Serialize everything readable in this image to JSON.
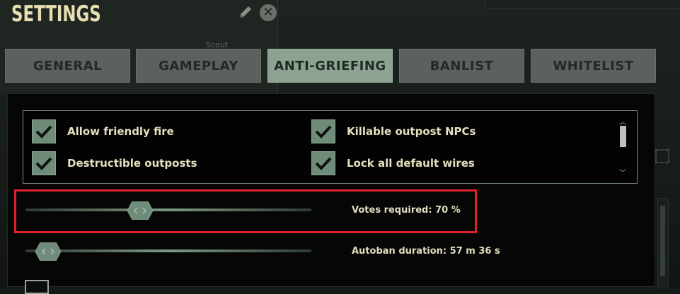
{
  "window": {
    "title": "SETTINGS",
    "background_hint": "Scout"
  },
  "tabs": [
    {
      "label": "GENERAL",
      "active": false
    },
    {
      "label": "GAMEPLAY",
      "active": false
    },
    {
      "label": "ANTI-GRIEFING",
      "active": true
    },
    {
      "label": "BANLIST",
      "active": false
    },
    {
      "label": "WHITELIST",
      "active": false
    }
  ],
  "checkboxes": [
    {
      "label": "Allow friendly fire",
      "checked": true
    },
    {
      "label": "Killable outpost NPCs",
      "checked": true
    },
    {
      "label": "Destructible outposts",
      "checked": true
    },
    {
      "label": "Lock all default wires",
      "checked": true
    }
  ],
  "sliders": [
    {
      "label": "Votes required: 70 %",
      "value_percent": 70,
      "fill_fraction": 0.4
    },
    {
      "label": "Autoban duration: 57 m 36 s",
      "fill_fraction": 0.08
    }
  ],
  "colors": {
    "accent": "#8ca392",
    "tab_inactive": "#5d615d",
    "checkbox": "#6f8c7a",
    "highlight": "#e0212e",
    "title": "#e9dfb3"
  },
  "icons": {
    "edit": "pencil-icon",
    "close": "close-icon",
    "checkmark": "checkmark-icon",
    "slider_handle": "slider-handle-icon"
  }
}
